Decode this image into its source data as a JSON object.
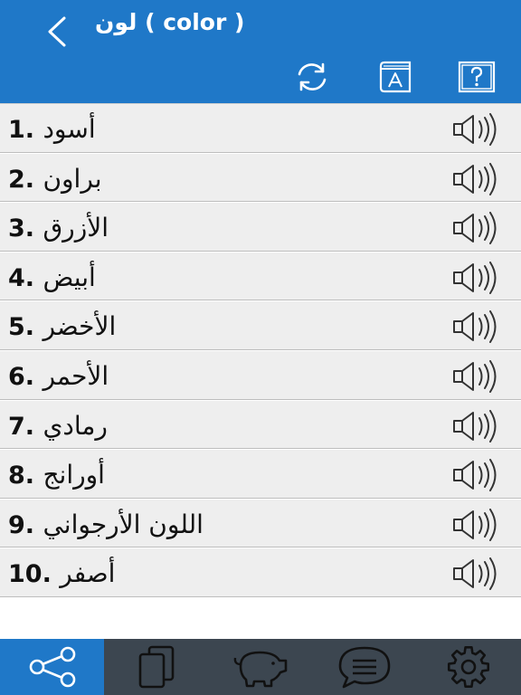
{
  "header": {
    "title": "لون ( color )",
    "back_icon": "chevron-left-icon",
    "toolbar": [
      {
        "name": "refresh-button",
        "icon": "refresh-icon"
      },
      {
        "name": "dictionary-button",
        "icon": "book-a-icon"
      },
      {
        "name": "help-button",
        "icon": "question-icon"
      }
    ]
  },
  "colors": {
    "accent": "#1f78c8",
    "bottom_bar": "#3c4650",
    "row_bg": "#eeeeee"
  },
  "items": [
    {
      "num": "1.",
      "word": "أسود"
    },
    {
      "num": "2.",
      "word": "براون"
    },
    {
      "num": "3.",
      "word": "الأزرق"
    },
    {
      "num": "4.",
      "word": "أبيض"
    },
    {
      "num": "5.",
      "word": "الأخضر"
    },
    {
      "num": "6.",
      "word": "الأحمر"
    },
    {
      "num": "7.",
      "word": "رمادي"
    },
    {
      "num": "8.",
      "word": "أورانج"
    },
    {
      "num": "9.",
      "word": "اللون الأرجواني"
    },
    {
      "num": "10.",
      "word": "أصفر"
    }
  ],
  "bottom_tabs": [
    {
      "icon": "share-icon",
      "active": true
    },
    {
      "icon": "copy-icon",
      "active": false
    },
    {
      "icon": "piggy-bank-icon",
      "active": false
    },
    {
      "icon": "chat-icon",
      "active": false
    },
    {
      "icon": "gear-icon",
      "active": false
    }
  ]
}
